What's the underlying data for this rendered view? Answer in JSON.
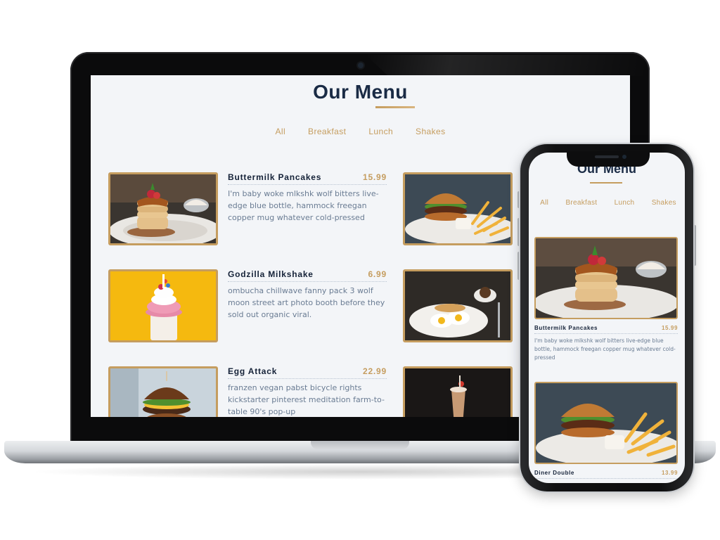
{
  "page": {
    "title": "Our Menu",
    "tabs": [
      "All",
      "Breakfast",
      "Lunch",
      "Shakes"
    ]
  },
  "menu": [
    {
      "name": "Buttermilk Pancakes",
      "price": "15.99",
      "desc": "I'm baby woke mlkshk wolf bitters live-edge blue bottle, hammock freegan copper mug whatever cold-pressed",
      "photo": "pancakes-photo"
    },
    {
      "name": "Godzilla Milkshake",
      "price": "6.99",
      "desc": "ombucha chillwave fanny pack 3 wolf moon street art photo booth before they sold out organic viral.",
      "photo": "milkshake-photo"
    },
    {
      "name": "Egg Attack",
      "price": "22.99",
      "desc": "franzen vegan pabst bicycle rights kickstarter pinterest meditation farm-to-table 90's pop-up",
      "photo": "burger-egg-photo"
    }
  ],
  "right_column_photos": [
    "burger-fries-photo",
    "eggs-breakfast-photo",
    "chocolate-shake-photo"
  ],
  "phone": {
    "items": [
      {
        "name": "Buttermilk Pancakes",
        "price": "15.99",
        "desc": "I'm baby woke mlkshk wolf bitters live-edge blue bottle, hammock freegan copper mug whatever cold-pressed"
      },
      {
        "name": "Diner Double",
        "price": "13.99"
      }
    ]
  },
  "colors": {
    "accent": "#c59d5f",
    "title": "#1a2b45",
    "text": "#6a7c93",
    "background": "#f3f5f8"
  }
}
